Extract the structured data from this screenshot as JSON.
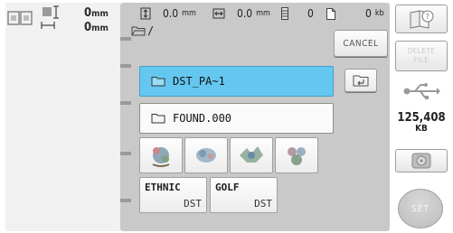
{
  "frame_size": {
    "width_value": "0",
    "height_value": "0",
    "unit": "mm"
  },
  "status": {
    "height_value": "0.0",
    "height_unit": "mm",
    "width_value": "0.0",
    "width_unit": "mm",
    "stitch_count": "0",
    "file_size_value": "0",
    "file_size_unit": "kb"
  },
  "path": "/",
  "buttons": {
    "cancel_label": "CANCEL",
    "delete_label_line1": "DELETE",
    "delete_label_line2": "FILE",
    "set_label": "SET"
  },
  "folders": [
    {
      "name": "DST_PA~1",
      "selected": true
    },
    {
      "name": "FOUND.000",
      "selected": false
    }
  ],
  "thumbnails": [
    "embroidery-preview-1",
    "embroidery-preview-2",
    "embroidery-preview-3",
    "embroidery-preview-4"
  ],
  "files": [
    {
      "name": "ETHNIC",
      "ext": "DST"
    },
    {
      "name": "GOLF",
      "ext": "DST"
    }
  ],
  "capacity": {
    "value": "125,408",
    "unit": "KB"
  },
  "colors": {
    "selected_row": "#64c7f0",
    "panel": "#c9c9c9",
    "left_pane": "#f1f1f1"
  }
}
